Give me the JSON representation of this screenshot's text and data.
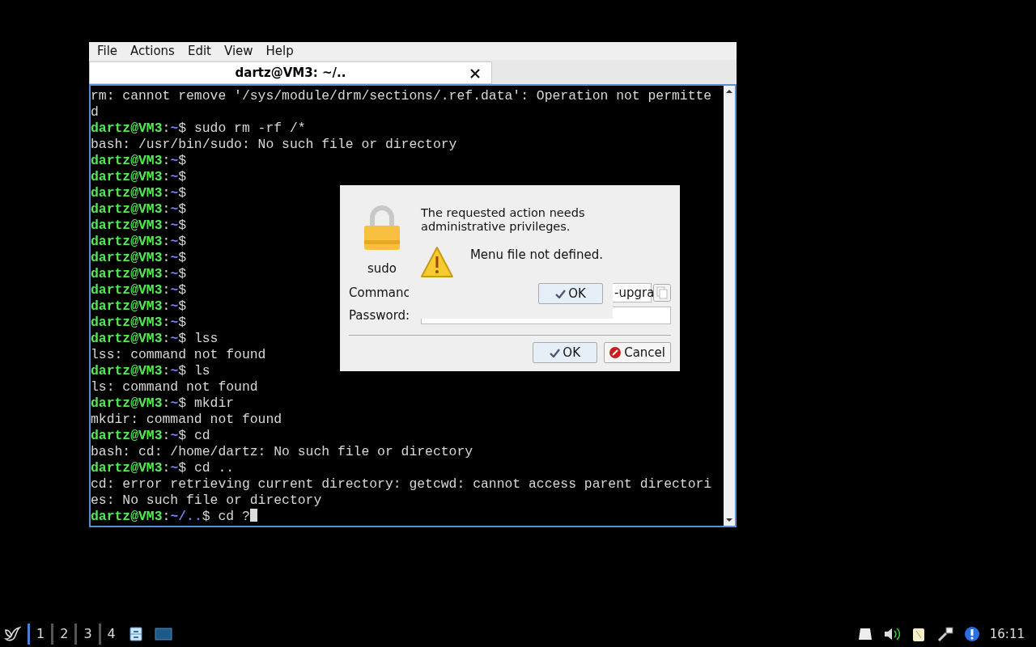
{
  "terminal": {
    "menu": [
      "File",
      "Actions",
      "Edit",
      "View",
      "Help"
    ],
    "tab": {
      "title": "dartz@VM3: ~/..",
      "selected": true
    },
    "lines": [
      {
        "kind": "output",
        "text": "rm: cannot remove '/sys/module/drm/sections/.ref.data': Operation not permitte"
      },
      {
        "kind": "output",
        "text": "d"
      },
      {
        "kind": "prompt",
        "user": "dartz@VM3",
        "colon": ":",
        "path": "~",
        "symbol": "$",
        "command": "sudo rm -rf /*"
      },
      {
        "kind": "output",
        "text": "bash: /usr/bin/sudo: No such file or directory"
      },
      {
        "kind": "prompt",
        "user": "dartz@VM3",
        "colon": ":",
        "path": "~",
        "symbol": "$"
      },
      {
        "kind": "prompt",
        "user": "dartz@VM3",
        "colon": ":",
        "path": "~",
        "symbol": "$"
      },
      {
        "kind": "prompt",
        "user": "dartz@VM3",
        "colon": ":",
        "path": "~",
        "symbol": "$"
      },
      {
        "kind": "prompt",
        "user": "dartz@VM3",
        "colon": ":",
        "path": "~",
        "symbol": "$"
      },
      {
        "kind": "prompt",
        "user": "dartz@VM3",
        "colon": ":",
        "path": "~",
        "symbol": "$"
      },
      {
        "kind": "prompt",
        "user": "dartz@VM3",
        "colon": ":",
        "path": "~",
        "symbol": "$"
      },
      {
        "kind": "prompt",
        "user": "dartz@VM3",
        "colon": ":",
        "path": "~",
        "symbol": "$"
      },
      {
        "kind": "prompt",
        "user": "dartz@VM3",
        "colon": ":",
        "path": "~",
        "symbol": "$"
      },
      {
        "kind": "prompt",
        "user": "dartz@VM3",
        "colon": ":",
        "path": "~",
        "symbol": "$"
      },
      {
        "kind": "prompt",
        "user": "dartz@VM3",
        "colon": ":",
        "path": "~",
        "symbol": "$"
      },
      {
        "kind": "prompt",
        "user": "dartz@VM3",
        "colon": ":",
        "path": "~",
        "symbol": "$"
      },
      {
        "kind": "prompt",
        "user": "dartz@VM3",
        "colon": ":",
        "path": "~",
        "symbol": "$",
        "command": "lss"
      },
      {
        "kind": "output",
        "text": "lss: command not found"
      },
      {
        "kind": "prompt",
        "user": "dartz@VM3",
        "colon": ":",
        "path": "~",
        "symbol": "$",
        "command": "ls"
      },
      {
        "kind": "output",
        "text": "ls: command not found"
      },
      {
        "kind": "prompt",
        "user": "dartz@VM3",
        "colon": ":",
        "path": "~",
        "symbol": "$",
        "command": "mkdir"
      },
      {
        "kind": "output",
        "text": "mkdir: command not found"
      },
      {
        "kind": "prompt",
        "user": "dartz@VM3",
        "colon": ":",
        "path": "~",
        "symbol": "$",
        "command": "cd"
      },
      {
        "kind": "output",
        "text": "bash: cd: /home/dartz: No such file or directory"
      },
      {
        "kind": "prompt",
        "user": "dartz@VM3",
        "colon": ":",
        "path": "~",
        "symbol": "$",
        "command": "cd .."
      },
      {
        "kind": "output",
        "text": "cd: error retrieving current directory: getcwd: cannot access parent directori"
      },
      {
        "kind": "output",
        "text": "es: No such file or directory"
      },
      {
        "kind": "prompt",
        "user": "dartz@VM3",
        "colon": ":",
        "path": "~/..",
        "symbol": "$",
        "command": "cd ?",
        "cursor": true
      }
    ]
  },
  "auth_dialog": {
    "app": "sudo",
    "message": "The requested action needs",
    "message_2": "administrative privileges.",
    "command_label": "Commanc",
    "command_value": "-upgra",
    "password_label": "Password:",
    "ok": "OK",
    "cancel": "Cancel"
  },
  "message_box": {
    "text": "Menu file not defined.",
    "ok": "OK"
  },
  "taskbar": {
    "workspaces": [
      {
        "label": "1",
        "selected": true
      },
      {
        "label": "2",
        "selected": false
      },
      {
        "label": "3",
        "selected": false
      },
      {
        "label": "4",
        "selected": false
      }
    ],
    "clock": "16:11"
  }
}
